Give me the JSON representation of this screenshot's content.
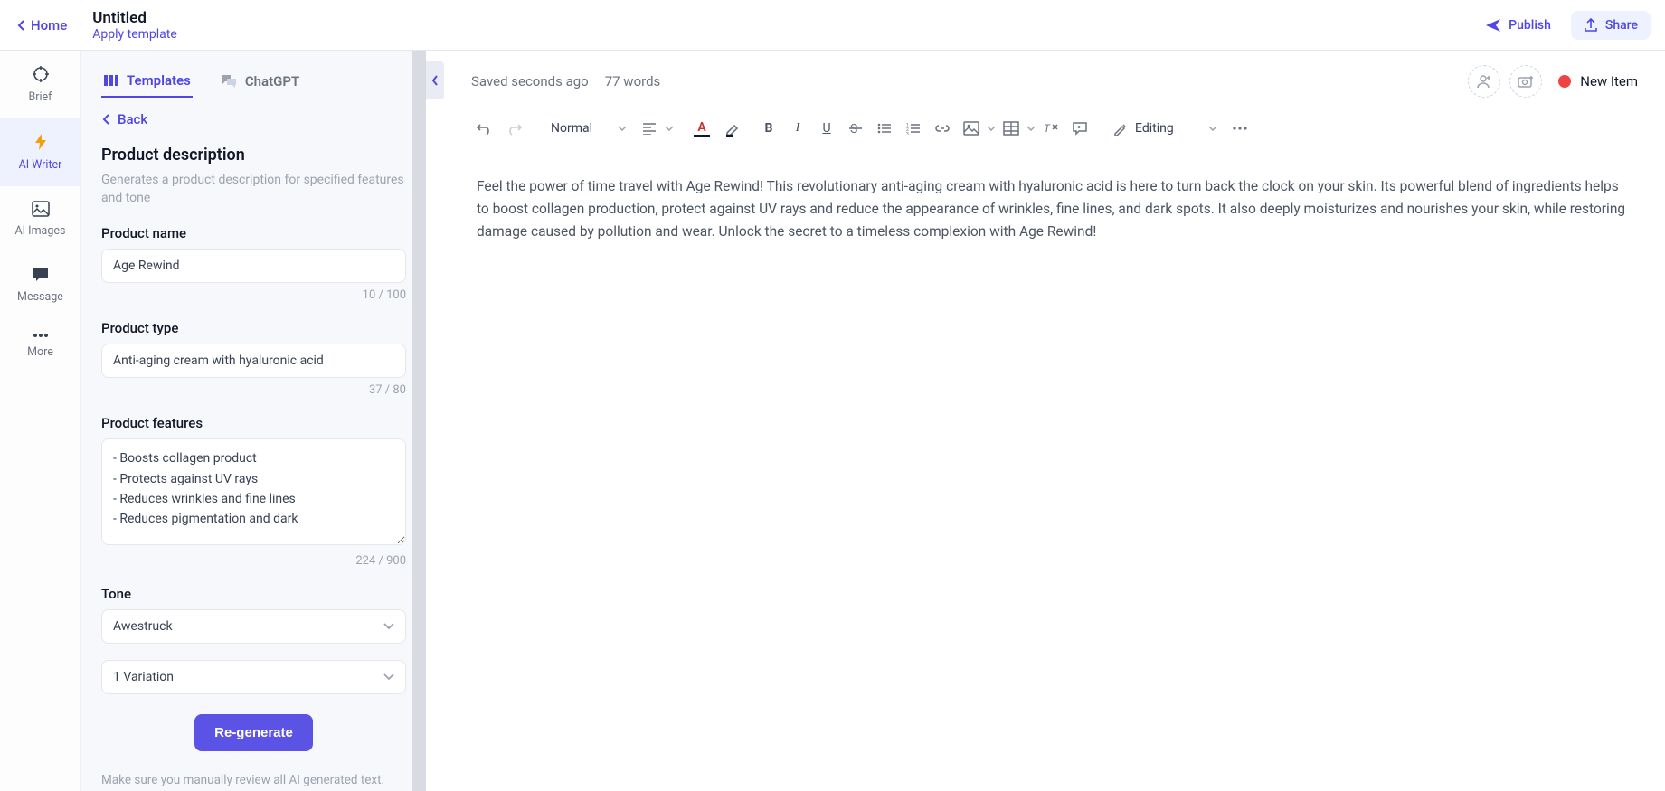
{
  "header": {
    "home": "Home",
    "title": "Untitled",
    "apply_template": "Apply template",
    "publish": "Publish",
    "share": "Share"
  },
  "nav": {
    "brief": "Brief",
    "ai_writer": "AI Writer",
    "ai_images": "AI Images",
    "message": "Message",
    "more": "More"
  },
  "side": {
    "tab_templates": "Templates",
    "tab_chatgpt": "ChatGPT",
    "back": "Back",
    "panel_title": "Product description",
    "panel_desc": "Generates a product description for specified features and tone",
    "product_name_label": "Product name",
    "product_name_value": "Age Rewind",
    "product_name_count": "10 / 100",
    "product_type_label": "Product type",
    "product_type_value": "Anti-aging cream with hyaluronic acid",
    "product_type_count": "37 / 80",
    "product_features_label": "Product features",
    "product_features_value": "- Boosts collagen product\n- Protects against UV rays\n- Reduces wrinkles and fine lines\n- Reduces pigmentation and dark",
    "product_features_count": "224 / 900",
    "tone_label": "Tone",
    "tone_value": "Awestruck",
    "variation_value": "1 Variation",
    "regenerate": "Re-generate",
    "note": "Make sure you manually review all AI generated text."
  },
  "editor": {
    "saved": "Saved seconds ago",
    "word_count": "77 words",
    "new_item": "New Item",
    "style_select": "Normal",
    "mode": "Editing",
    "body": "Feel the power of time travel with Age Rewind! This revolutionary anti-aging cream with hyaluronic acid is here to turn back the clock on your skin. Its powerful blend of ingredients helps to boost collagen production, protect against UV rays and reduce the appearance of wrinkles, fine lines, and dark spots. It also deeply moisturizes and nourishes your skin, while restoring damage caused by pollution and wear. Unlock the secret to a timeless complexion with Age Rewind!"
  }
}
